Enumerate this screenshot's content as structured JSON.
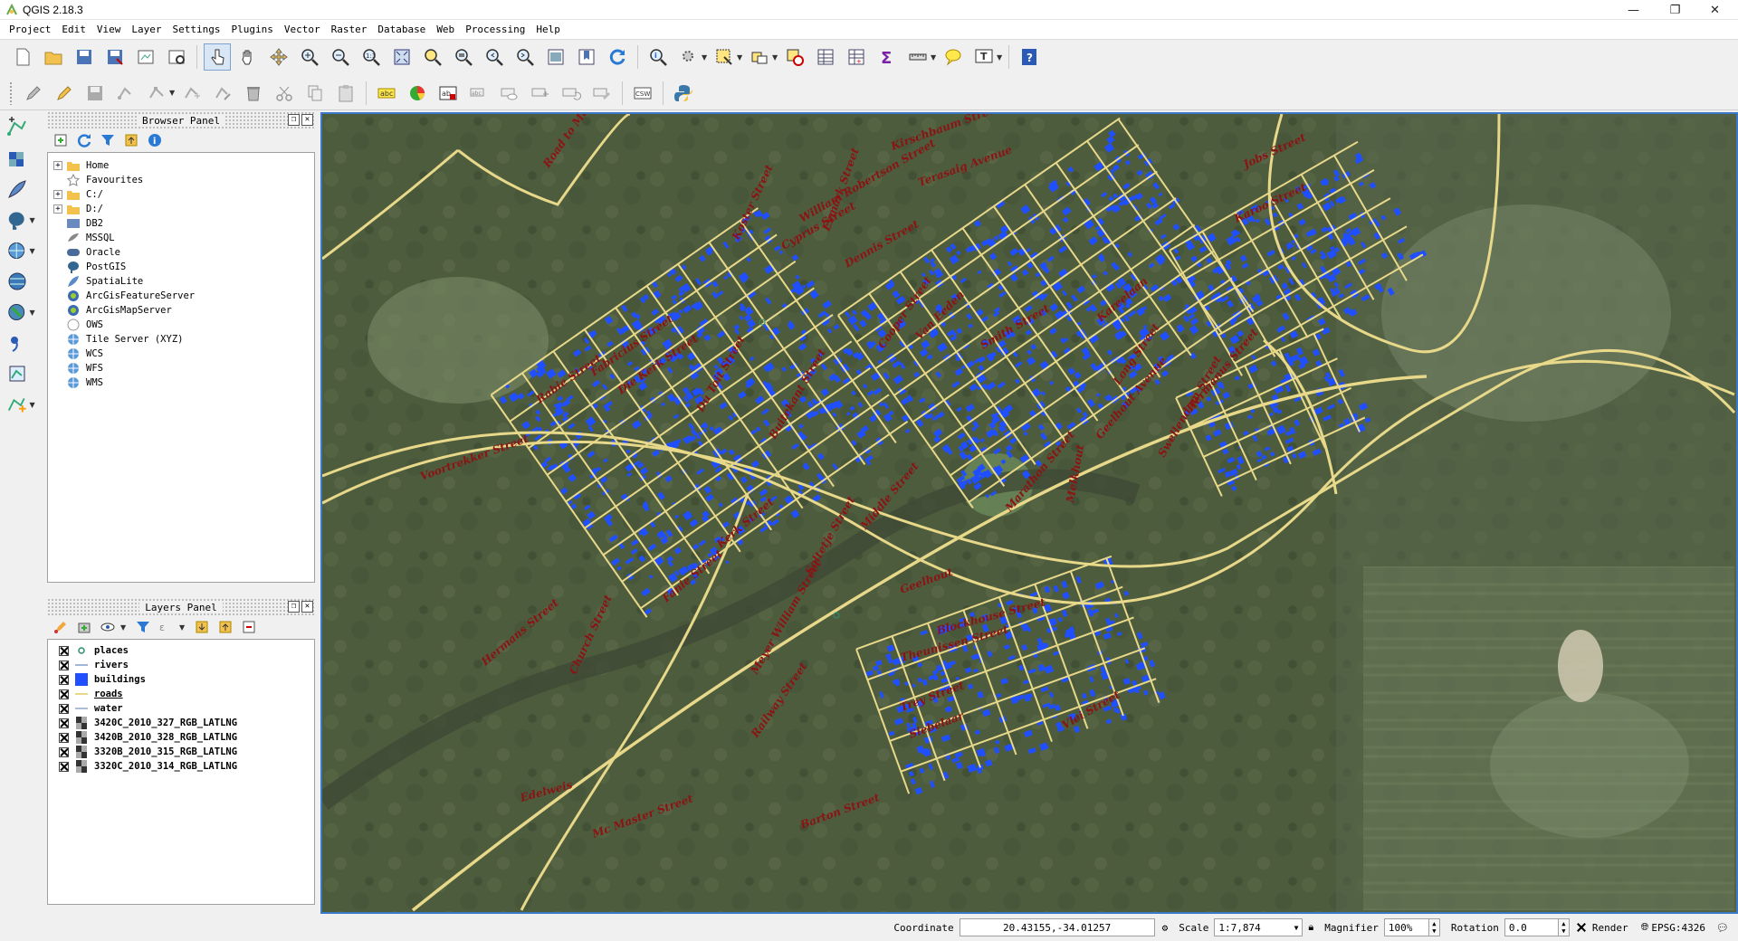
{
  "window": {
    "title": "QGIS 2.18.3",
    "minimize_icon": "minimize-icon",
    "restore_icon": "restore-icon",
    "close_icon": "close-icon"
  },
  "menu": [
    "Project",
    "Edit",
    "View",
    "Layer",
    "Settings",
    "Plugins",
    "Vector",
    "Raster",
    "Database",
    "Web",
    "Processing",
    "Help"
  ],
  "browser_panel": {
    "title": "Browser Panel",
    "items": [
      {
        "label": "Home",
        "icon": "folder-icon",
        "expandable": true
      },
      {
        "label": "Favourites",
        "icon": "star-icon",
        "expandable": false
      },
      {
        "label": "C:/",
        "icon": "folder-icon",
        "expandable": true
      },
      {
        "label": "D:/",
        "icon": "folder-icon",
        "expandable": true
      },
      {
        "label": "DB2",
        "icon": "db2-icon",
        "expandable": false
      },
      {
        "label": "MSSQL",
        "icon": "mssql-icon",
        "expandable": false
      },
      {
        "label": "Oracle",
        "icon": "oracle-icon",
        "expandable": false
      },
      {
        "label": "PostGIS",
        "icon": "postgis-icon",
        "expandable": false
      },
      {
        "label": "SpatiaLite",
        "icon": "spatialite-icon",
        "expandable": false
      },
      {
        "label": "ArcGisFeatureServer",
        "icon": "arcgis-icon",
        "expandable": false
      },
      {
        "label": "ArcGisMapServer",
        "icon": "arcgis-icon",
        "expandable": false
      },
      {
        "label": "OWS",
        "icon": "ows-icon",
        "expandable": false
      },
      {
        "label": "Tile Server (XYZ)",
        "icon": "globe-icon",
        "expandable": false
      },
      {
        "label": "WCS",
        "icon": "globe-icon",
        "expandable": false
      },
      {
        "label": "WFS",
        "icon": "globe-icon",
        "expandable": false
      },
      {
        "label": "WMS",
        "icon": "globe-icon",
        "expandable": false
      }
    ]
  },
  "layers_panel": {
    "title": "Layers Panel",
    "layers": [
      {
        "name": "places",
        "symbol": "point",
        "color": "#2f8f6f",
        "checked": true,
        "underline": false
      },
      {
        "name": "rivers",
        "symbol": "line",
        "color": "#7f9fc8",
        "checked": true,
        "underline": false
      },
      {
        "name": "buildings",
        "symbol": "fill",
        "color": "#1f4fff",
        "checked": true,
        "underline": false
      },
      {
        "name": "roads",
        "symbol": "line",
        "color": "#e8d88a",
        "checked": true,
        "underline": true
      },
      {
        "name": "water",
        "symbol": "fill",
        "color": "#5a78a8",
        "checked": true,
        "underline": false
      },
      {
        "name": "3420C_2010_327_RGB_LATLNG",
        "symbol": "raster",
        "color": "#6a6a6a",
        "checked": true,
        "underline": false
      },
      {
        "name": "3420B_2010_328_RGB_LATLNG",
        "symbol": "raster",
        "color": "#6a6a6a",
        "checked": true,
        "underline": false
      },
      {
        "name": "3320B_2010_315_RGB_LATLNG",
        "symbol": "raster",
        "color": "#6a6a6a",
        "checked": true,
        "underline": false
      },
      {
        "name": "3320C_2010_314_RGB_LATLNG",
        "symbol": "raster",
        "color": "#6a6a6a",
        "checked": true,
        "underline": false
      }
    ]
  },
  "map": {
    "street_labels": [
      "Road to Marloth Nature Re",
      "Kirschbaum Street",
      "Terasaig Avenue",
      "William Robertson Street",
      "Cyprus Street",
      "Koster Street",
      "Esmark Street",
      "Rabie Street",
      "Fabricius Street",
      "Die Kerk Street",
      "Du Toit Street",
      "Buitekant Street",
      "Voortrekker Street",
      "Van Eeden",
      "Long Street",
      "Swellendam Street",
      "Hermanus Street",
      "Jobs Street",
      "Karoo Street",
      "Kareelaan",
      "Geelhout Avenue",
      "Melkhout",
      "Geelhout",
      "Blockhouse Street",
      "Theunissen Street",
      "Trey Street",
      "Siebelaar",
      "Soltetje Street",
      "Meyer William Street",
      "Middle Street",
      "Cooper Street",
      "Smith Street",
      "Barton Street",
      "Railway Street",
      "Church Street",
      "Mc Master Street",
      "Edelweis",
      "Hermans Street",
      "Vlei Street",
      "Marathon Street",
      "Dennis Street",
      "Kerk Street",
      "Fanie Street"
    ],
    "colors": {
      "roads": "#e8d88a",
      "buildings": "#1f4fff",
      "labels": "#8a1414",
      "imagery": "#4d5a3c"
    }
  },
  "statusbar": {
    "coordinate_label": "Coordinate",
    "coordinate_value": "20.43155,-34.01257",
    "scale_label": "Scale",
    "scale_value": "1:7,874",
    "magnifier_label": "Magnifier",
    "magnifier_value": "100%",
    "rotation_label": "Rotation",
    "rotation_value": "0.0",
    "render_label": "Render",
    "crs_label": "EPSG:4326"
  }
}
